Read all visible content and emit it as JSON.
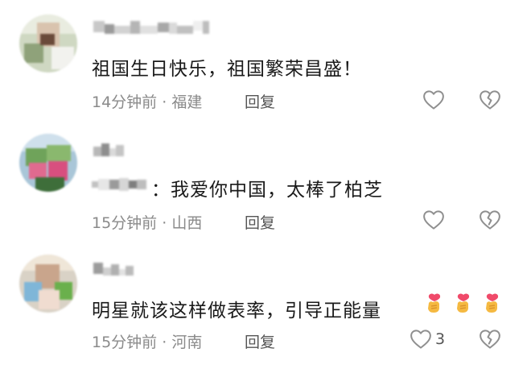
{
  "comments": [
    {
      "text": "祖国生日快乐，祖国繁荣昌盛！",
      "time": "14分钟前",
      "location": "福建",
      "reply_label": "回复",
      "like_count": ""
    },
    {
      "text": "：我爱你中国，太棒了柏芝",
      "time": "15分钟前",
      "location": "山西",
      "reply_label": "回复",
      "like_count": ""
    },
    {
      "text": "明星就该这样做表率，引导正能量",
      "time": "15分钟前",
      "location": "河南",
      "reply_label": "回复",
      "like_count": "3"
    }
  ],
  "separator": " · ",
  "icons": {
    "like": "heart-outline-icon",
    "dislike": "broken-heart-icon",
    "emoji": "finger-heart-emoji"
  },
  "colors": {
    "text": "#1a1a1a",
    "meta": "#8a8a8a",
    "icon": "#8f8f8f"
  }
}
